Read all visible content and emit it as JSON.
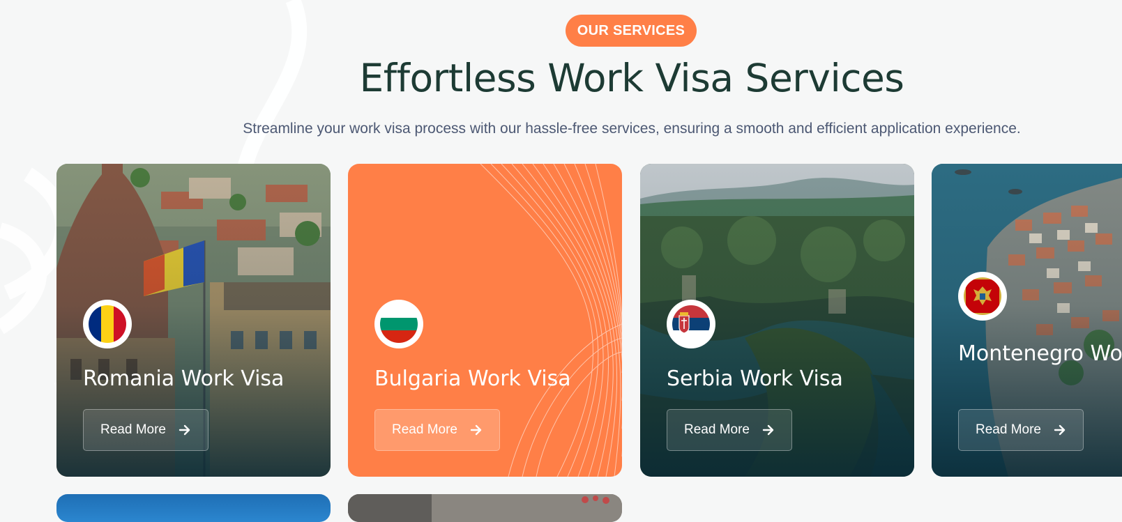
{
  "section": {
    "badge": "OUR SERVICES",
    "title": "Effortless Work Visa Services",
    "subtitle": "Streamline your work visa process with our hassle-free services, ensuring a smooth and efficient application experience."
  },
  "colors": {
    "accent": "#ff7f47",
    "heading": "#1d3b34",
    "body_text": "#4c5873",
    "background": "#f6f7f7"
  },
  "cards": [
    {
      "title": "Romania Work Visa",
      "button": "Read More",
      "flag_icon": "romania-flag-icon",
      "style": "photo"
    },
    {
      "title": "Bulgaria Work Visa",
      "button": "Read More",
      "flag_icon": "bulgaria-flag-icon",
      "style": "orange"
    },
    {
      "title": "Serbia Work Visa",
      "button": "Read More",
      "flag_icon": "serbia-flag-icon",
      "style": "photo"
    },
    {
      "title": "Montenegro Work Visa",
      "button": "Read More",
      "flag_icon": "montenegro-flag-icon",
      "style": "photo"
    }
  ],
  "icons": {
    "button_arrow": "arrow-right-icon"
  }
}
